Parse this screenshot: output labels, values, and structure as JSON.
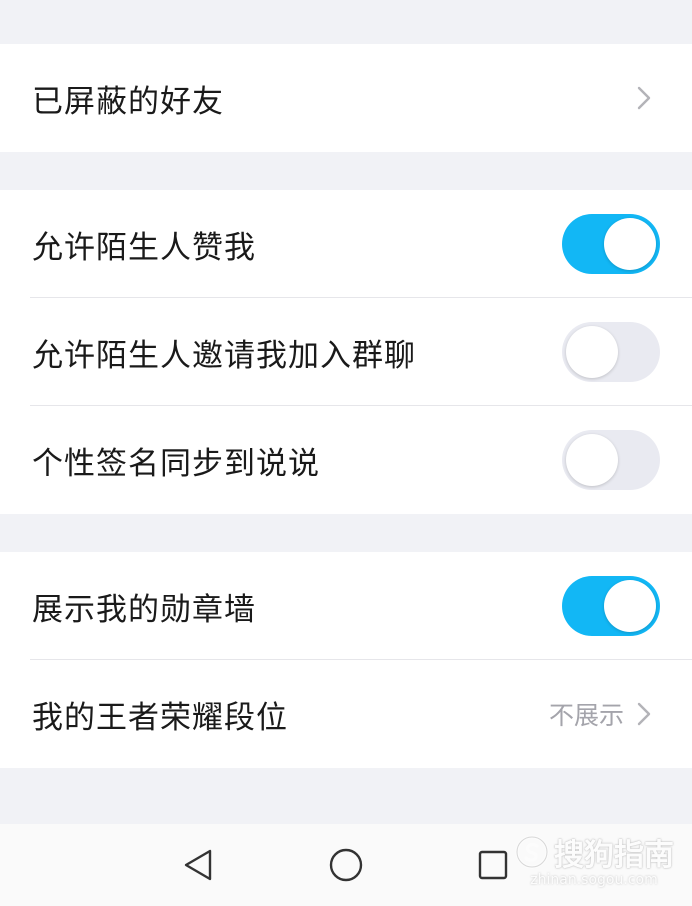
{
  "settings": {
    "blocked_friends": {
      "label": "已屏蔽的好友"
    },
    "allow_stranger_like": {
      "label": "允许陌生人赞我",
      "enabled": true
    },
    "allow_stranger_group_invite": {
      "label": "允许陌生人邀请我加入群聊",
      "enabled": false
    },
    "sync_signature": {
      "label": "个性签名同步到说说",
      "enabled": false
    },
    "show_badge_wall": {
      "label": "展示我的勋章墙",
      "enabled": true
    },
    "honor_of_kings_rank": {
      "label": "我的王者荣耀段位",
      "value": "不展示"
    }
  },
  "navigation": {
    "back_icon": "triangle-back-icon",
    "home_icon": "circle-home-icon",
    "recents_icon": "square-recents-icon"
  },
  "watermark": {
    "text": "搜狗指南",
    "subtext": "zhinan.sogou.com"
  },
  "colors": {
    "toggle_on": "#12b7f5",
    "toggle_off": "#e9eaf1",
    "background": "#f1f2f6",
    "secondary_text": "#a4a4ab"
  }
}
